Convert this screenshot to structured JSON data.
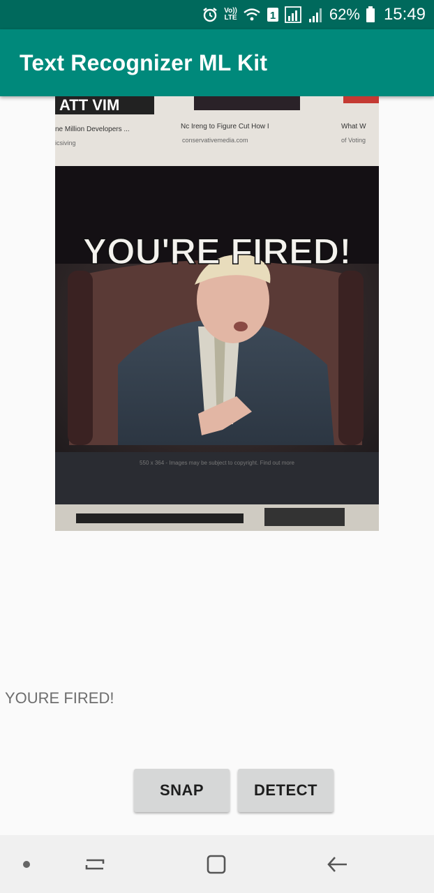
{
  "status_bar": {
    "volte_label": "Vo))\nLTE",
    "sim_number": "1",
    "battery_percent": "62%",
    "time": "15:49",
    "icons": [
      "alarm-icon",
      "volte-icon",
      "wifi-icon",
      "sim-1-icon",
      "signal-icon",
      "signal-icon-2",
      "battery-icon"
    ]
  },
  "app_bar": {
    "title": "Text Recognizer ML Kit",
    "color": "#00897b",
    "status_color": "#00695c"
  },
  "photo": {
    "meme_caption": "YOU'RE FIRED!",
    "top_snippets": [
      "ne Million Developers ...",
      "Nc Ireng to Figure Cut How I",
      "What W"
    ],
    "top_sub_snippets": [
      "icsiving",
      "conservativemedia.com",
      "of Voting"
    ],
    "footer_snippet": "550 x 364 - Images may be subject to copyright. Find out more",
    "description": "photo-of-screen"
  },
  "result": {
    "text": "YOURE FIRED!"
  },
  "buttons": {
    "snap_label": "SNAP",
    "detect_label": "DETECT"
  },
  "nav_bar": {
    "icons": [
      "dot-icon",
      "recent-apps-icon",
      "home-icon",
      "back-icon"
    ]
  }
}
